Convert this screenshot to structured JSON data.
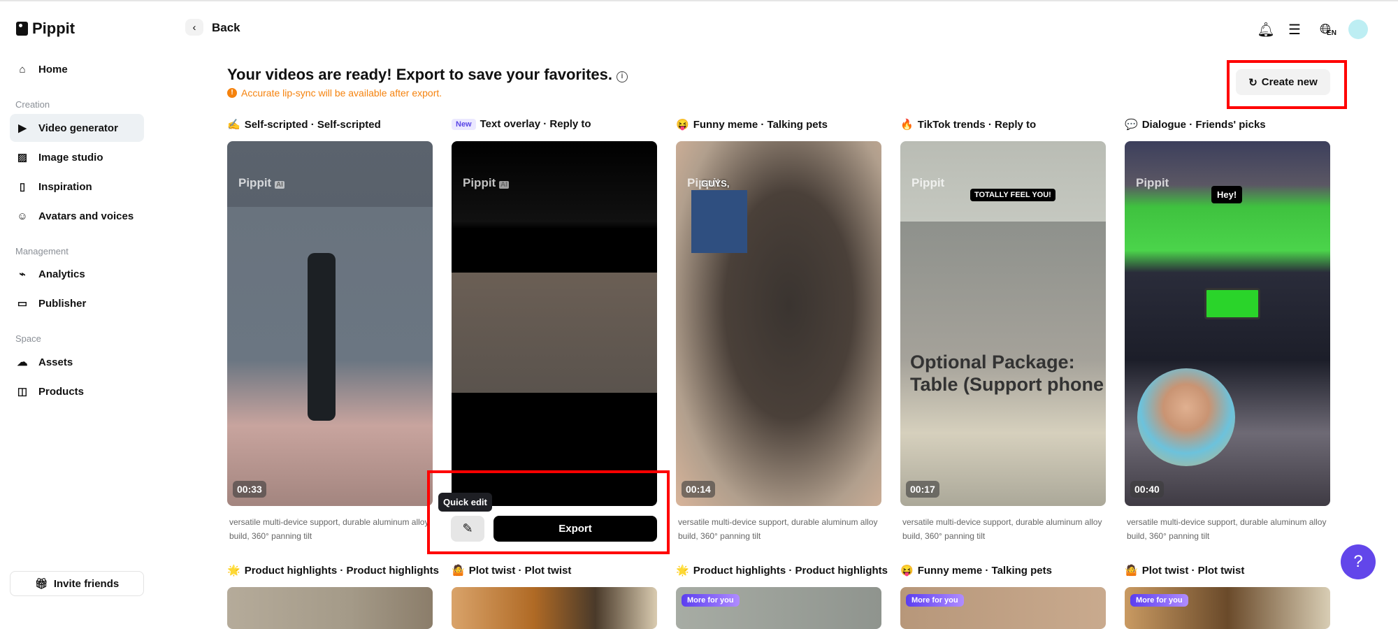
{
  "app": {
    "name": "Pippit"
  },
  "sidebar": {
    "items": [
      {
        "label": "Home",
        "icon": "home-icon"
      },
      {
        "label": "Video generator",
        "icon": "video-generator-icon"
      },
      {
        "label": "Image studio",
        "icon": "image-studio-icon"
      },
      {
        "label": "Inspiration",
        "icon": "inspiration-icon"
      },
      {
        "label": "Avatars and voices",
        "icon": "avatar-icon"
      },
      {
        "label": "Analytics",
        "icon": "analytics-icon"
      },
      {
        "label": "Publisher",
        "icon": "calendar-icon"
      },
      {
        "label": "Assets",
        "icon": "cloud-icon"
      },
      {
        "label": "Products",
        "icon": "bag-icon"
      }
    ],
    "sections": [
      "Creation",
      "Management",
      "Space"
    ],
    "invite": "Invite friends"
  },
  "header": {
    "back": "Back",
    "lang": "EN"
  },
  "main": {
    "title": "Your videos are ready! Export to save your favorites.",
    "warning": "Accurate lip-sync will be available after export.",
    "create_new": "Create new",
    "watermark": "Pippit",
    "watermark_badge": "AI",
    "quick_edit_tooltip": "Quick edit",
    "export": "Export",
    "new_badge": "New",
    "more_badge": "More for you",
    "cards": [
      {
        "emoji": "✍️",
        "title": "Self-scripted · Self-scripted",
        "duration": "00:33",
        "desc": "versatile multi-device support, durable aluminum alloy build, 360° panning tilt"
      },
      {
        "emoji": "",
        "title": "Text overlay · Reply to",
        "duration": "",
        "desc": ""
      },
      {
        "emoji": "😝",
        "title": "Funny meme · Talking pets",
        "duration": "00:14",
        "desc": "versatile multi-device support, durable aluminum alloy build, 360° panning tilt",
        "caption": "GUYS,"
      },
      {
        "emoji": "🔥",
        "title": "TikTok trends · Reply to",
        "duration": "00:17",
        "desc": "versatile multi-device support, durable aluminum alloy build, 360° panning tilt",
        "caption": "TOTALLY FEEL YOU!",
        "overlay": "Optional Package: Table (Support phone and ta"
      },
      {
        "emoji": "💬",
        "title": "Dialogue · Friends' picks",
        "duration": "00:40",
        "desc": "versatile multi-device support, durable aluminum alloy build, 360° panning tilt",
        "caption": "Hey!"
      }
    ],
    "row2": [
      {
        "emoji": "🌟",
        "title": "Product highlights · Product highlights"
      },
      {
        "emoji": "🤷",
        "title": "Plot twist · Plot twist"
      },
      {
        "emoji": "🌟",
        "title": "Product highlights · Product highlights"
      },
      {
        "emoji": "😝",
        "title": "Funny meme · Talking pets"
      },
      {
        "emoji": "🤷",
        "title": "Plot twist · Plot twist"
      }
    ]
  },
  "colors": {
    "accent": "#6246ea",
    "warning": "#f5820d",
    "highlight": "#ff0000"
  }
}
